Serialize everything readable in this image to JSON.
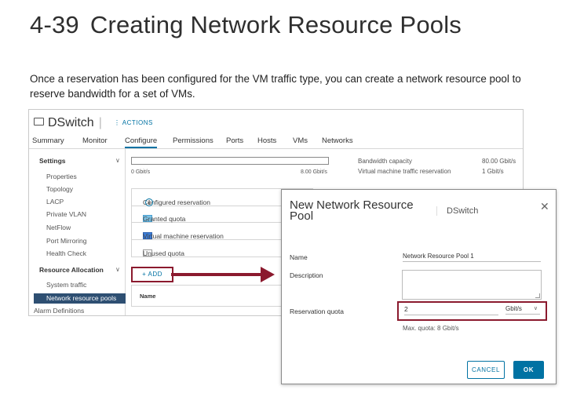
{
  "slide": {
    "number": "4-39",
    "title": "Creating Network Resource Pools",
    "intro": "Once a reservation has been configured for the VM traffic type, you can create a network resource pool to reserve bandwidth for a set of VMs."
  },
  "dswitch": {
    "name": "DSwitch",
    "actions_label": "ACTIONS",
    "tabs": [
      "Summary",
      "Monitor",
      "Configure",
      "Permissions",
      "Ports",
      "Hosts",
      "VMs",
      "Networks"
    ],
    "active_tab": "Configure",
    "sidebar": {
      "settings_header": "Settings",
      "settings_items": [
        "Properties",
        "Topology",
        "LACP",
        "Private VLAN",
        "NetFlow",
        "Port Mirroring",
        "Health Check"
      ],
      "resource_header": "Resource Allocation",
      "resource_items": [
        "System traffic",
        "Network resource pools"
      ],
      "selected_item": "Network resource pools",
      "trailing_item": "Alarm Definitions"
    },
    "bandwidth": {
      "min_label": "0 Gbit/s",
      "max_label": "8.00 Gbit/s",
      "capacity_label": "Bandwidth capacity",
      "capacity_value": "80.00 Gbit/s",
      "vm_reservation_label": "Virtual machine traffic reservation",
      "vm_reservation_value": "1 Gbit/s"
    },
    "legend": {
      "configured_reservation": "Configured reservation",
      "granted_quota": "Granted quota",
      "vm_reservation": "Virtual machine reservation",
      "unused_quota": "Unused quota"
    },
    "add_button": "+ ADD",
    "grid_header_name": "Name"
  },
  "dialog": {
    "title": "New Network Resource Pool",
    "subtitle": "DSwitch",
    "name_label": "Name",
    "name_value": "Network Resource Pool 1",
    "description_label": "Description",
    "description_value": "",
    "quota_label": "Reservation quota",
    "quota_value": "2",
    "quota_unit": "Gbit/s",
    "max_quota": "Max. quota: 8 Gbit/s",
    "cancel_label": "CANCEL",
    "ok_label": "OK"
  },
  "icons": [
    "switch-icon",
    "kebab-icon",
    "chevron-down-icon",
    "info-icon",
    "close-icon",
    "arrow-icon"
  ],
  "colors": {
    "accent": "#0072a3",
    "highlight": "#8b1a2e",
    "selected_nav": "#2e4f72",
    "granted_swatch": "#7cc3e8",
    "vm_swatch": "#3b7dd8"
  }
}
